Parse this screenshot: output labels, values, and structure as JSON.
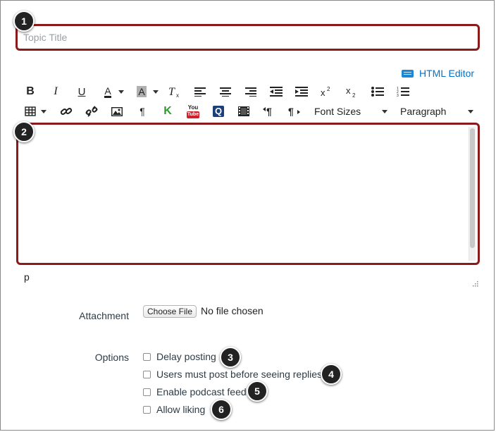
{
  "title_field": {
    "placeholder": "Topic Title",
    "value": ""
  },
  "callouts": [
    "1",
    "2",
    "3",
    "4",
    "5",
    "6"
  ],
  "html_editor": {
    "label": "HTML Editor",
    "icon": "keyboard-icon"
  },
  "toolbar": {
    "row1_icons": [
      "bold-icon",
      "italic-icon",
      "underline-icon",
      "text-color-icon",
      "background-color-icon",
      "clear-formatting-icon",
      "align-left-icon",
      "align-center-icon",
      "align-right-icon",
      "outdent-icon",
      "indent-icon",
      "superscript-icon",
      "subscript-icon",
      "bullet-list-icon",
      "numbered-list-icon"
    ],
    "row2_icons": [
      "table-icon",
      "link-icon",
      "unlink-icon",
      "image-icon",
      "paragraph-icon",
      "kaltura-icon",
      "youtube-icon",
      "quizlet-icon",
      "media-icon",
      "ltr-icon",
      "rtl-icon"
    ],
    "bold": "B",
    "italic": "I",
    "underline": "U",
    "text_color": "A",
    "background_color": "A",
    "youtube_top": "You",
    "youtube_bottom": "Tube",
    "quizlet": "Q",
    "kaltura": "K",
    "paragraph_mark": "¶",
    "font_sizes": "Font Sizes",
    "paragraph": "Paragraph"
  },
  "editor": {
    "path": "p"
  },
  "attachment": {
    "label": "Attachment",
    "button": "Choose File",
    "status": "No file chosen"
  },
  "options": {
    "label": "Options",
    "items": [
      {
        "label": "Delay posting",
        "checked": false
      },
      {
        "label": "Users must post before seeing replies",
        "checked": false
      },
      {
        "label": "Enable podcast feed",
        "checked": false
      },
      {
        "label": "Allow liking",
        "checked": false
      }
    ]
  },
  "colors": {
    "highlight": "#8b1a1a",
    "link": "#0770c4",
    "badge": "#222222"
  }
}
